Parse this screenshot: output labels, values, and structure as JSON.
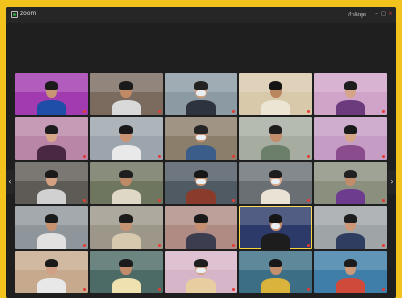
{
  "window": {
    "app_label": "zoom",
    "host_label": "กำลังพูด",
    "min_glyph": "–",
    "max_glyph": "□",
    "close_glyph": "×"
  },
  "navigation": {
    "prev_glyph": "‹",
    "next_glyph": "›"
  },
  "colors": {
    "page_background": "#f2c21d",
    "window_background": "#1f1f1f",
    "active_speaker_border": "#f7d43c",
    "muted_mic": "#e53935"
  },
  "participants": [
    {
      "name": "",
      "bg": "#a23ab0",
      "skin": "#c99574",
      "hair": "#1b1b1b",
      "shirt": "#1e4ea8",
      "mask": false,
      "speaking": false
    },
    {
      "name": "",
      "bg": "#7a6b5e",
      "skin": "#c08a66",
      "hair": "#1a1a1a",
      "shirt": "#d9d9d9",
      "mask": false,
      "speaking": false
    },
    {
      "name": "",
      "bg": "#8c9aa3",
      "skin": "#d2a07f",
      "hair": "#222222",
      "shirt": "#2e3340",
      "mask": true,
      "speaking": false
    },
    {
      "name": "",
      "bg": "#d9c9ab",
      "skin": "#b98660",
      "hair": "#141414",
      "shirt": "#ece5d4",
      "mask": false,
      "speaking": false
    },
    {
      "name": "",
      "bg": "#d0a3c9",
      "skin": "#d6a487",
      "hair": "#1e1e1e",
      "shirt": "#6b3b7e",
      "mask": false,
      "speaking": false
    },
    {
      "name": "",
      "bg": "#b986a7",
      "skin": "#d8a78a",
      "hair": "#1c1c1c",
      "shirt": "#4a2743",
      "mask": false,
      "speaking": false
    },
    {
      "name": "",
      "bg": "#9ca5ad",
      "skin": "#c89473",
      "hair": "#1a1a1a",
      "shirt": "#e9e9e9",
      "mask": false,
      "speaking": false
    },
    {
      "name": "",
      "bg": "#8b7e6a",
      "skin": "#c79575",
      "hair": "#252525",
      "shirt": "#3a5d8a",
      "mask": true,
      "speaking": false
    },
    {
      "name": "",
      "bg": "#a7aca1",
      "skin": "#c18d6b",
      "hair": "#1e1e1e",
      "shirt": "#6b7f6a",
      "mask": false,
      "speaking": false
    },
    {
      "name": "",
      "bg": "#c59cc4",
      "skin": "#d6a486",
      "hair": "#1a1a1a",
      "shirt": "#8b4c8e",
      "mask": false,
      "speaking": false
    },
    {
      "name": "",
      "bg": "#5e5a55",
      "skin": "#d4a183",
      "hair": "#1a1a1a",
      "shirt": "#d1d1d1",
      "mask": false,
      "speaking": false
    },
    {
      "name": "",
      "bg": "#6f7660",
      "skin": "#bd8966",
      "hair": "#1f1f1f",
      "shirt": "#e0d8c6",
      "mask": false,
      "speaking": false
    },
    {
      "name": "",
      "bg": "#4f5a63",
      "skin": "#c8946f",
      "hair": "#171717",
      "shirt": "#8a3b2c",
      "mask": true,
      "speaking": false
    },
    {
      "name": "",
      "bg": "#6a6f74",
      "skin": "#d9aa8e",
      "hair": "#1d1d1d",
      "shirt": "#e9e2d5",
      "mask": true,
      "speaking": false
    },
    {
      "name": "",
      "bg": "#8a8f7e",
      "skin": "#c28d6a",
      "hair": "#222222",
      "shirt": "#6d3c8f",
      "mask": false,
      "speaking": false
    },
    {
      "name": "",
      "bg": "#8f969b",
      "skin": "#c89270",
      "hair": "#1b1b1b",
      "shirt": "#e1e1e1",
      "mask": false,
      "speaking": false
    },
    {
      "name": "",
      "bg": "#9d9789",
      "skin": "#c79473",
      "hair": "#1c1c1c",
      "shirt": "#d6c9ad",
      "mask": false,
      "speaking": false
    },
    {
      "name": "",
      "bg": "#b08b84",
      "skin": "#c69070",
      "hair": "#1a1a1a",
      "shirt": "#3c3d4f",
      "mask": false,
      "speaking": false
    },
    {
      "name": "",
      "bg": "#2c3a6a",
      "skin": "#c58e6c",
      "hair": "#161616",
      "shirt": "#1d1d1d",
      "mask": true,
      "speaking": true
    },
    {
      "name": "",
      "bg": "#9fa4a6",
      "skin": "#cc9878",
      "hair": "#1e1e1e",
      "shirt": "#2f3e60",
      "mask": false,
      "speaking": false
    },
    {
      "name": "",
      "bg": "#c7aa8d",
      "skin": "#d2a084",
      "hair": "#1a1a1a",
      "shirt": "#e8e8e8",
      "mask": false,
      "speaking": false
    },
    {
      "name": "",
      "bg": "#4d6b66",
      "skin": "#c28c6a",
      "hair": "#1b1b1b",
      "shirt": "#efe2b0",
      "mask": false,
      "speaking": false
    },
    {
      "name": "",
      "bg": "#d7b5c8",
      "skin": "#d1a083",
      "hair": "#1e1e1e",
      "shirt": "#e7cda0",
      "mask": true,
      "speaking": false
    },
    {
      "name": "",
      "bg": "#3c6f86",
      "skin": "#c48f6d",
      "hair": "#181818",
      "shirt": "#d9b33b",
      "mask": false,
      "speaking": false
    },
    {
      "name": "",
      "bg": "#3f7ea8",
      "skin": "#cc9a7b",
      "hair": "#1c1c1c",
      "shirt": "#cf4a3a",
      "mask": false,
      "speaking": false
    }
  ]
}
